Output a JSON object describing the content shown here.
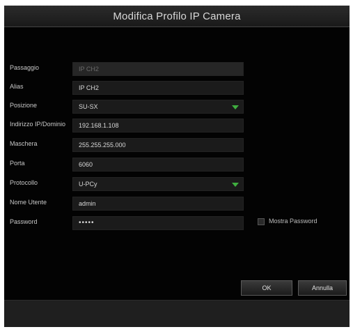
{
  "dialog": {
    "title": "Modifica Profilo IP Camera"
  },
  "form": {
    "passaggio": {
      "label": "Passaggio",
      "value": "IP CH2"
    },
    "alias": {
      "label": "Alias",
      "value": "IP CH2"
    },
    "posizione": {
      "label": "Posizione",
      "value": "SU-SX"
    },
    "indirizzo": {
      "label": "Indirizzo IP/Dominio",
      "value": "192.168.1.108"
    },
    "maschera": {
      "label": "Maschera",
      "value": "255.255.255.000"
    },
    "porta": {
      "label": "Porta",
      "value": "6060"
    },
    "protocollo": {
      "label": "Protocollo",
      "value": "U-PCy"
    },
    "nome_utente": {
      "label": "Nome Utente",
      "value": "admin"
    },
    "password": {
      "label": "Password",
      "value": "•••••"
    },
    "mostra_password": {
      "label": "Mostra Password",
      "checked": false
    }
  },
  "buttons": {
    "ok": "OK",
    "annulla": "Annulla"
  },
  "colors": {
    "background": "#030303",
    "field": "#1b1b1b",
    "accent_arrow": "#3fae3f",
    "text": "#c8c8c8"
  },
  "icons": {
    "dropdown": "chevron-down-icon",
    "checkbox": "checkbox-icon"
  }
}
